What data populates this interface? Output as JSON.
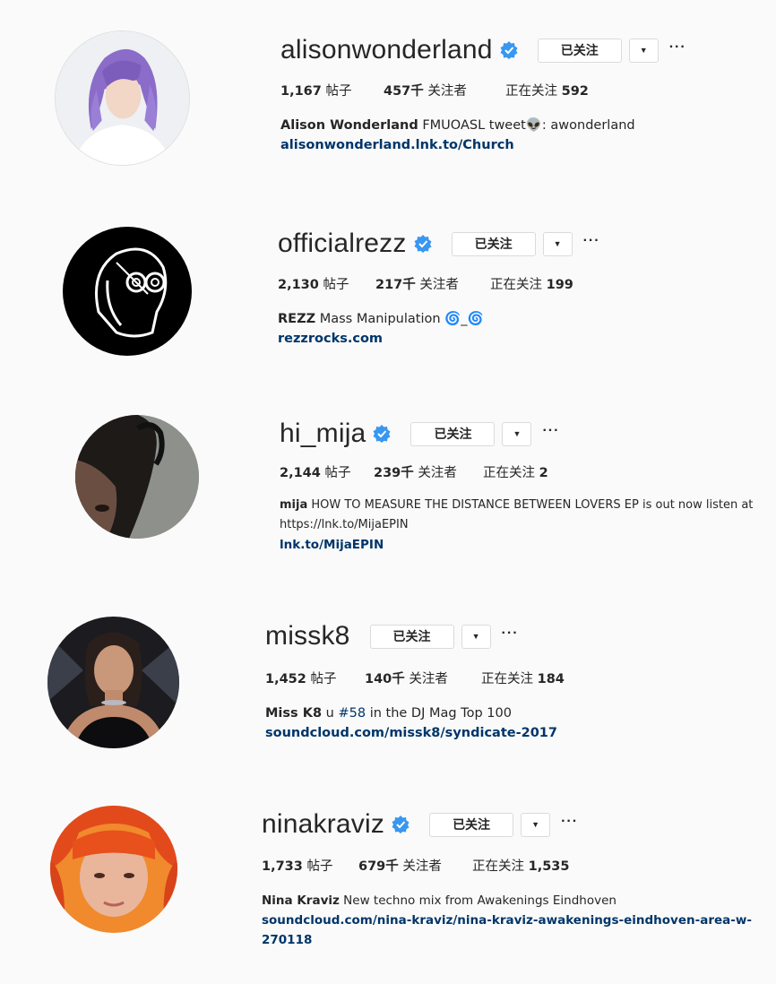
{
  "follow_label": "已关注",
  "stats_labels": {
    "posts": "帖子",
    "followers": "关注者",
    "following_prefix": "正在关注"
  },
  "profiles": [
    {
      "username": "alisonwonderland",
      "verified": true,
      "posts": "1,167",
      "followers": "457千",
      "following": "592",
      "full_name": "Alison Wonderland",
      "bio": "FMUOASL  tweet",
      "bio_tail": ": awonderland",
      "bio_line2": "",
      "link": "alisonwonderland.lnk.to/Church"
    },
    {
      "username": "officialrezz",
      "verified": true,
      "posts": "2,130",
      "followers": "217千",
      "following": "199",
      "full_name": "REZZ",
      "bio": "Mass Manipulation",
      "bio_tail": "",
      "bio_line2": "",
      "link": "rezzrocks.com"
    },
    {
      "username": "hi_mija",
      "verified": true,
      "posts": "2,144",
      "followers": "239千",
      "following": "2",
      "full_name": "mija",
      "bio": "HOW TO MEASURE THE DISTANCE BETWEEN LOVERS EP is out now  listen at",
      "bio_tail": "",
      "bio_line2": "https://lnk.to/MijaEPIN",
      "link": "lnk.to/MijaEPIN"
    },
    {
      "username": "missk8",
      "verified": false,
      "posts": "1,452",
      "followers": "140千",
      "following": "184",
      "full_name": "Miss K8",
      "bio": "u",
      "bio_tag": "#58",
      "bio_tail": "in the DJ Mag Top 100",
      "bio_line2": "",
      "link": "soundcloud.com/missk8/syndicate-2017"
    },
    {
      "username": "ninakraviz",
      "verified": true,
      "posts": "1,733",
      "followers": "679千",
      "following": "1,535",
      "full_name": "Nina Kraviz",
      "bio": "New techno mix from Awakenings Eindhoven",
      "bio_tail": "",
      "bio_line2": "",
      "link": "soundcloud.com/nina-kraviz/nina-kraviz-awakenings-eindhoven-area-w-270118"
    }
  ],
  "colors": {
    "link": "#003569",
    "verified": "#3897f0",
    "border": "#dbdbdb",
    "background": "#fafafa"
  }
}
